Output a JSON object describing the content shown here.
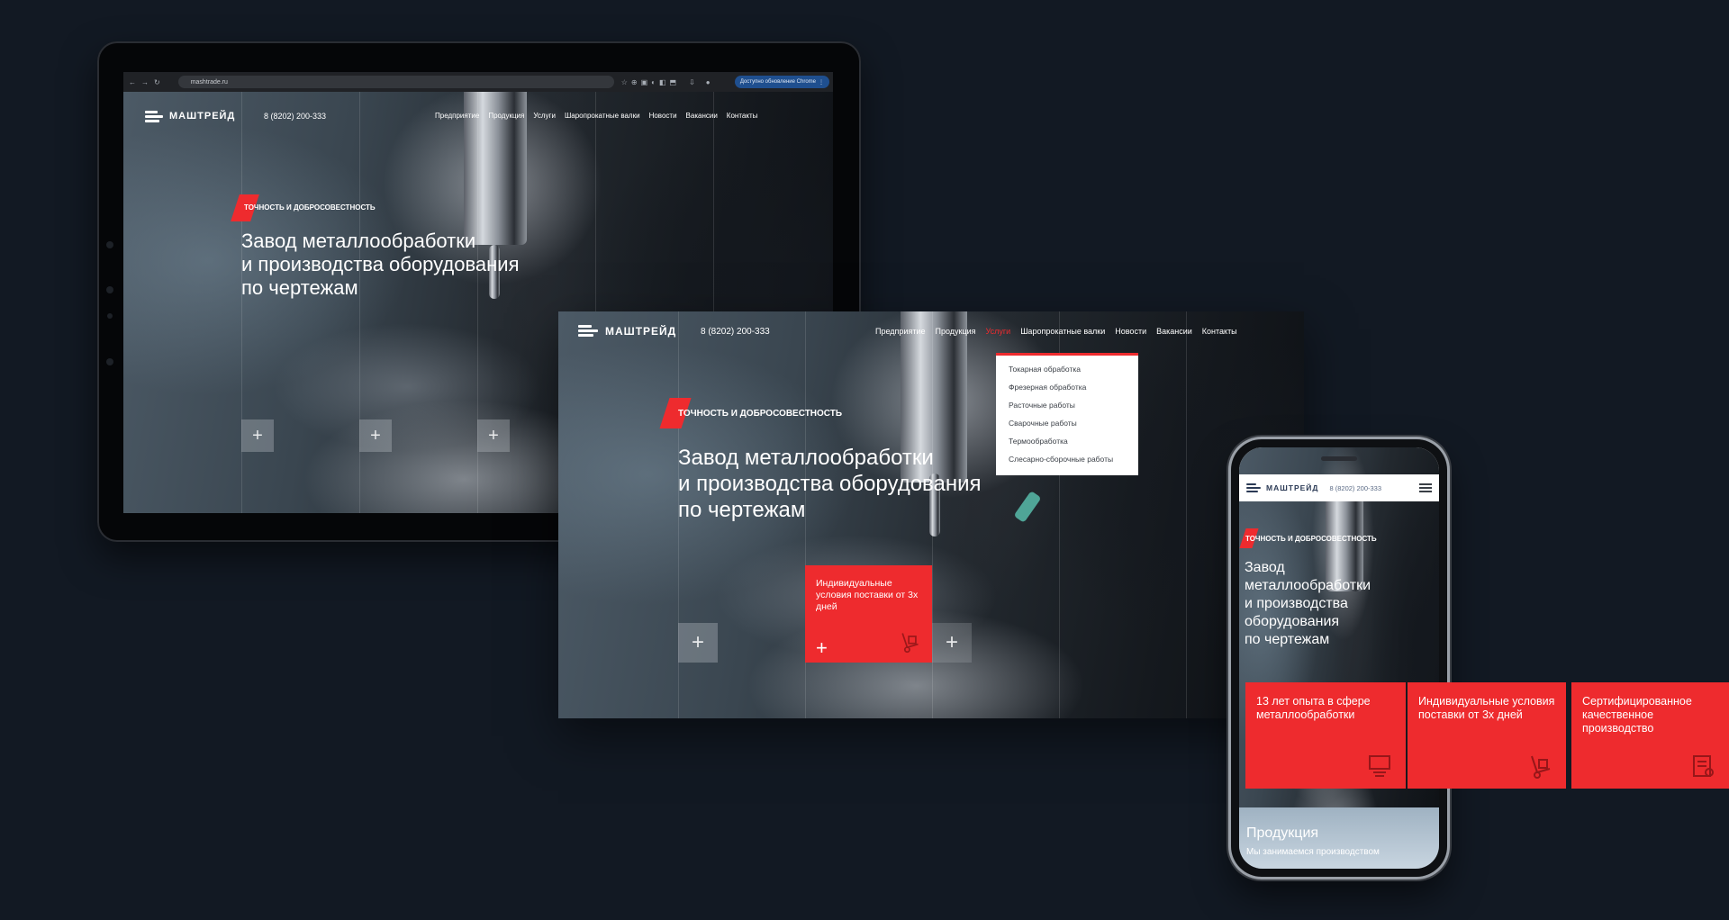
{
  "brand": {
    "logo_text": "МАШТРЕЙД",
    "phone_desktop": "8 (8202) 200-333",
    "phone_mobile": "8 (8202) 200-333"
  },
  "browser": {
    "url": "mashtrade.ru",
    "update_button": "Доступно обновление Chrome"
  },
  "nav": {
    "items": [
      "Предприятие",
      "Продукция",
      "Услуги",
      "Шаропрокатные валки",
      "Новости",
      "Вакансии",
      "Контакты"
    ],
    "active": "Услуги"
  },
  "services_dropdown": {
    "items": [
      "Токарная обработка",
      "Фрезерная обработка",
      "Расточные работы",
      "Сварочные работы",
      "Термообработка",
      "Слесарно-сборочные работы"
    ]
  },
  "hero": {
    "tagline": "Точность и добросовестность",
    "title_line1": "Завод металлообработки",
    "title_line2": "и производства оборудования",
    "title_line3": "по чертежам",
    "mobile_title_line1": "Завод",
    "mobile_title_line2": "металлообработки",
    "mobile_title_line3": "и производства",
    "mobile_title_line4": "оборудования",
    "mobile_title_line5": "по чертежам",
    "plus_symbol": "+"
  },
  "feature_cards": [
    {
      "text": "13 лет опыта в сфере металлообработки",
      "icon": "award-icon"
    },
    {
      "text": "Индивидуальные условия поставки от 3х дней",
      "icon": "hand-truck-icon"
    },
    {
      "text": "Сертифицированное качественное производство",
      "icon": "certificate-icon"
    }
  ],
  "desktop_card": {
    "text": "Индивидуальные условия поставки от 3х дней"
  },
  "products": {
    "heading": "Продукция",
    "lead": "Мы занимаемся производством"
  },
  "colors": {
    "background": "#121923",
    "accent_red": "#ee2b2e",
    "logo_blue": "#2b3a55"
  }
}
